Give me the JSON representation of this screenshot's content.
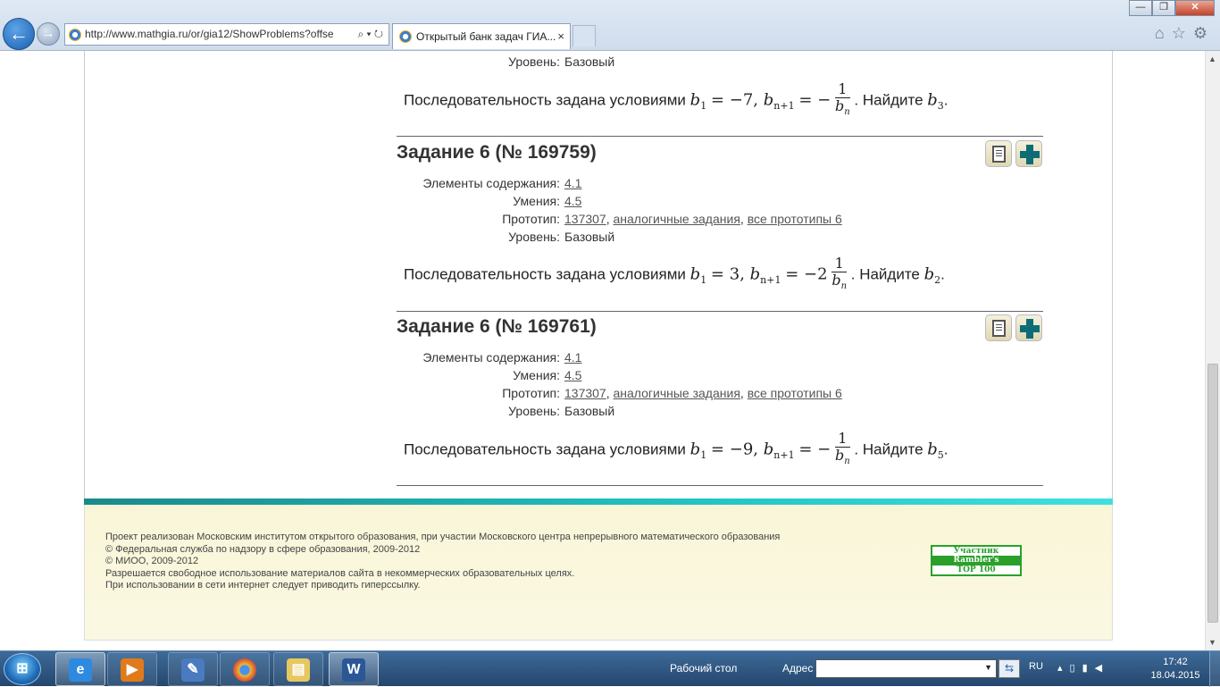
{
  "browser": {
    "url": "http://www.mathgia.ru/or/gia12/ShowProblems?offse",
    "tab_title": "Открытый банк задач ГИА...",
    "tab_close": "×",
    "address_controls": "⌕ ▾ ↻",
    "window_buttons": {
      "minimize": "—",
      "maximize": "❐",
      "close": "✕"
    },
    "toolbar_icons": [
      "home-icon",
      "star-icon",
      "gear-icon"
    ]
  },
  "previous_task": {
    "level_label": "Уровень:",
    "level_value": "Базовый",
    "problem_prefix": "Последовательность задана условиями",
    "cond1": {
      "var": "b",
      "sub": "1",
      "rhs": "−7"
    },
    "cond2": {
      "var": "b",
      "sub": "n+1",
      "sign": "−",
      "coef": "",
      "num": "1",
      "den": "b",
      "den_sub": "n"
    },
    "problem_suffix": ". Найдите",
    "find": {
      "var": "b",
      "sub": "3"
    }
  },
  "tasks": [
    {
      "title": "Задание 6 (№ 169759)",
      "elements_label": "Элементы содержания:",
      "elements_value": "4.1",
      "skills_label": "Умения:",
      "skills_value": "4.5",
      "prototype_label": "Прототип:",
      "prototype_id": "137307",
      "similar_link": "аналогичные задания",
      "all_prototypes_link": "все прототипы 6",
      "level_label": "Уровень:",
      "level_value": "Базовый",
      "problem_prefix": "Последовательность задана условиями",
      "cond1": {
        "var": "b",
        "sub": "1",
        "rhs": "3"
      },
      "cond2": {
        "var": "b",
        "sub": "n+1",
        "sign": "−",
        "coef": "2",
        "num": "1",
        "den": "b",
        "den_sub": "n"
      },
      "problem_suffix": ". Найдите",
      "find": {
        "var": "b",
        "sub": "2"
      }
    },
    {
      "title": "Задание 6 (№ 169761)",
      "elements_label": "Элементы содержания:",
      "elements_value": "4.1",
      "skills_label": "Умения:",
      "skills_value": "4.5",
      "prototype_label": "Прототип:",
      "prototype_id": "137307",
      "similar_link": "аналогичные задания",
      "all_prototypes_link": "все прототипы 6",
      "level_label": "Уровень:",
      "level_value": "Базовый",
      "problem_prefix": "Последовательность задана условиями",
      "cond1": {
        "var": "b",
        "sub": "1",
        "rhs": "−9"
      },
      "cond2": {
        "var": "b",
        "sub": "n+1",
        "sign": "−",
        "coef": "",
        "num": "1",
        "den": "b",
        "den_sub": "n"
      },
      "problem_suffix": ". Найдите",
      "find": {
        "var": "b",
        "sub": "5"
      }
    }
  ],
  "footer": {
    "lines": [
      "Проект реализован Московским институтом открытого образования, при участии Московского центра непрерывного математического образования",
      "© Федеральная служба по надзору в сфере образования, 2009-2012",
      "© МИОО, 2009-2012",
      "Разрешается свободное использование материалов сайта в некоммерческих образовательных целях.",
      "При использовании в сети интернет следует приводить гиперссылку."
    ],
    "rambler": {
      "line1": "Участник",
      "line2": "Rambler's",
      "line3": "TOP 100"
    }
  },
  "taskbar": {
    "desktop_label": "Рабочий стол",
    "address_label": "Адрес",
    "language": "RU",
    "time": "17:42",
    "date": "18.04.2015",
    "apps": [
      "internet-explorer-icon",
      "media-player-icon",
      "paint-icon",
      "chrome-icon",
      "file-explorer-icon",
      "word-icon"
    ]
  },
  "colors": {
    "footer_accent": "#22c4c4",
    "rambler_green": "#2aa02a",
    "plus_teal": "#0e6c76"
  }
}
